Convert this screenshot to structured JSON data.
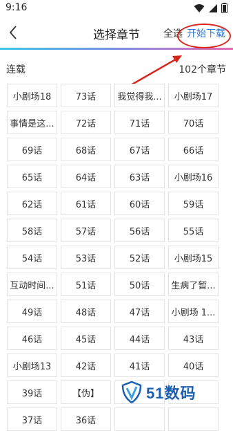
{
  "status_bar": {
    "time": "9:16"
  },
  "header": {
    "title": "选择章节",
    "select_all": "全选",
    "start_download": "开始下载"
  },
  "section": {
    "left_label": "连载",
    "right_label": "102个章节"
  },
  "chapters": [
    "小剧场18",
    "73话",
    "我觉得我...",
    "小剧场17",
    "事情是这...",
    "72话",
    "71话",
    "70话",
    "69话",
    "68话",
    "67话",
    "66话",
    "65话",
    "64话",
    "63话",
    "小剧场16",
    "62话",
    "61话",
    "60话",
    "59话",
    "58话",
    "57话",
    "56话",
    "55话",
    "54话",
    "53话",
    "52话",
    "小剧场15",
    "互动时间...",
    "51话",
    "50话",
    "生病了暂...",
    "49话",
    "48话",
    "47话",
    "小剧场 1...",
    "46话",
    "45话",
    "44话",
    "43话",
    "小剧场13",
    "42话",
    "41话",
    "40话",
    "39话",
    "【伪】",
    "",
    "",
    "37话",
    "36话",
    "",
    ""
  ],
  "watermark": {
    "text": "51数码"
  },
  "colors": {
    "accent": "#2d7ad6",
    "annotation": "#d8261d"
  }
}
